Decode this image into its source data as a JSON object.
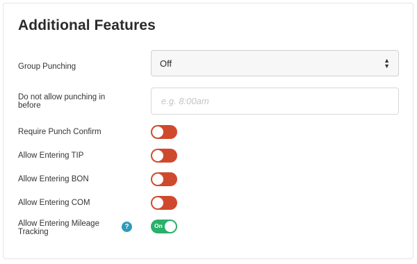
{
  "title": "Additional Features",
  "group_punching": {
    "label": "Group Punching",
    "value": "Off"
  },
  "no_punch_before": {
    "label": "Do not allow punching in before",
    "placeholder": "e.g. 8:00am",
    "value": ""
  },
  "toggles": [
    {
      "label": "Require Punch Confirm",
      "state": "off"
    },
    {
      "label": "Allow Entering TIP",
      "state": "off"
    },
    {
      "label": "Allow Entering BON",
      "state": "off"
    },
    {
      "label": "Allow Entering COM",
      "state": "off"
    },
    {
      "label": "Allow Entering Mileage Tracking",
      "state": "on",
      "on_text": "On"
    }
  ],
  "help_icon": {
    "glyph": "?"
  },
  "colors": {
    "toggle_off": "#cf4a2c",
    "toggle_on": "#29b06a",
    "help": "#2e9bb8"
  }
}
